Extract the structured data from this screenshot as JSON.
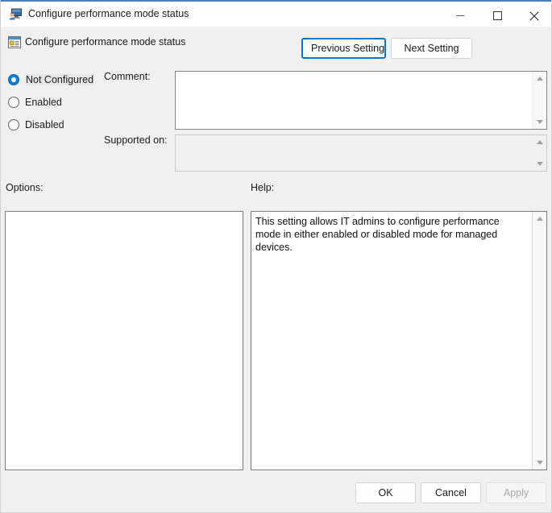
{
  "window": {
    "title": "Configure performance mode status",
    "title_icon": "computer-user-monitor-icon",
    "minimize_label": "Minimize",
    "maximize_label": "Maximize",
    "close_label": "Close",
    "accent_color": "#4a7ebb"
  },
  "header": {
    "icon": "policy-setting-window-icon",
    "title": "Configure performance mode status",
    "previous_button": "Previous Setting",
    "next_button": "Next Setting",
    "focus_color": "#0078d4"
  },
  "state_options": {
    "selected": "Not Configured",
    "items": [
      {
        "label": "Not Configured",
        "selected": true
      },
      {
        "label": "Enabled",
        "selected": false
      },
      {
        "label": "Disabled",
        "selected": false
      }
    ],
    "selected_color": "#0a7ce0"
  },
  "comment": {
    "label": "Comment:",
    "value": "",
    "enabled": true
  },
  "supported_on": {
    "label": "Supported on:",
    "value": "",
    "enabled": false
  },
  "options": {
    "label": "Options:",
    "items": []
  },
  "help": {
    "label": "Help:",
    "text": "This setting allows IT admins to configure performance mode in either enabled or disabled mode for managed devices."
  },
  "footer": {
    "ok_label": "OK",
    "cancel_label": "Cancel",
    "apply_label": "Apply",
    "apply_enabled": false
  },
  "scrollbars": {
    "up_arrow": "scroll-up-arrow",
    "down_arrow": "scroll-down-arrow"
  }
}
